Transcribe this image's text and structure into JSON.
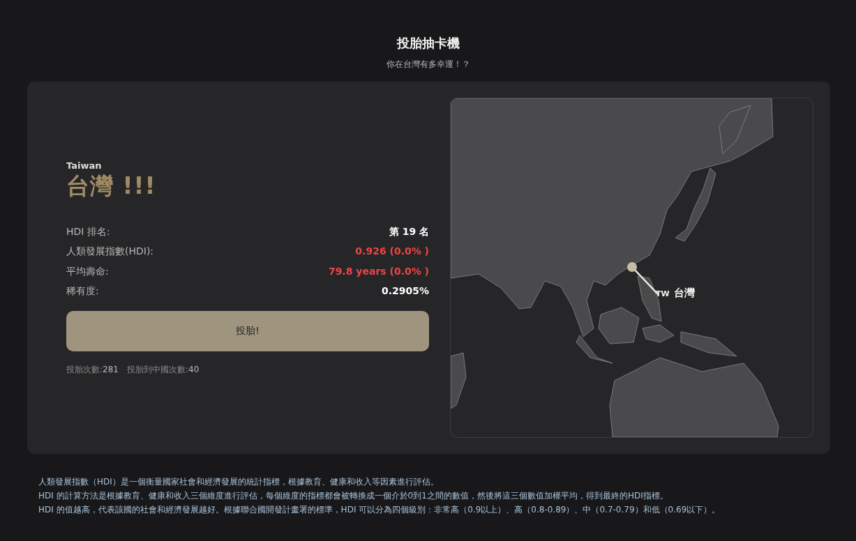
{
  "header": {
    "title": "投胎抽卡機",
    "subtitle": "你在台灣有多幸運！？"
  },
  "result": {
    "name_en": "Taiwan",
    "name": "台灣 !!!"
  },
  "stats": [
    {
      "label": "HDI 排名:",
      "value": "第 19 名",
      "color": "#ffffff"
    },
    {
      "label": "人類發展指數(HDI):",
      "value": "0.926 (0.0% )",
      "color": "#ef4444"
    },
    {
      "label": "平均壽命:",
      "value": "79.8 years (0.0% )",
      "color": "#ef4444"
    },
    {
      "label": "稀有度:",
      "value": "0.2905%",
      "color": "#ffffff"
    }
  ],
  "button": "投胎!",
  "counters": [
    {
      "label": "投胎次數:",
      "value": "281"
    },
    {
      "label": "投胎到中國次數:",
      "value": "40"
    }
  ],
  "map": {
    "marker_code": "TW",
    "marker_label": "台灣"
  },
  "footer": [
    "人類發展指數（HDI）是一個衡量國家社會和經濟發展的統計指標，根據教育、健康和收入等因素進行評估。",
    "HDI 的計算方法是根據教育、健康和收入三個維度進行評估，每個維度的指標都會被轉換成一個介於0到1之間的數值，然後將這三個數值加權平均，得到最終的HDI指標。",
    "HDI 的值越高，代表該國的社會和經濟發展越好。根據聯合國開發計畫署的標準，HDI 可以分為四個級別：非常高（0.9以上）、高（0.8-0.89）、中（0.7-0.79）和低（0.69以下）。"
  ]
}
